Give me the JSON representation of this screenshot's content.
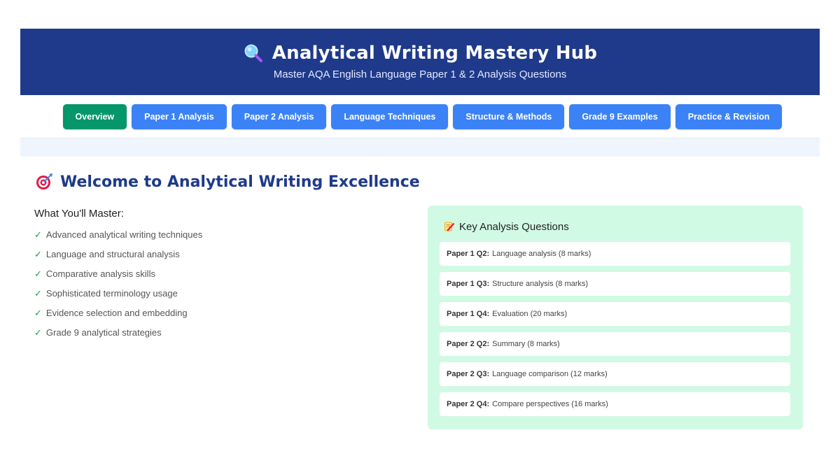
{
  "header": {
    "title": "Analytical Writing Mastery Hub",
    "subtitle": "Master AQA English Language Paper 1 & 2 Analysis Questions",
    "icon": "magnifier-icon"
  },
  "nav": {
    "items": [
      {
        "label": "Overview",
        "active": true
      },
      {
        "label": "Paper 1 Analysis",
        "active": false
      },
      {
        "label": "Paper 2 Analysis",
        "active": false
      },
      {
        "label": "Language Techniques",
        "active": false
      },
      {
        "label": "Structure & Methods",
        "active": false
      },
      {
        "label": "Grade 9 Examples",
        "active": false
      },
      {
        "label": "Practice & Revision",
        "active": false
      }
    ]
  },
  "welcome": {
    "title": "Welcome to Analytical Writing Excellence",
    "icon": "target-icon"
  },
  "master": {
    "heading": "What You'll Master:",
    "items": [
      "Advanced analytical writing techniques",
      "Language and structural analysis",
      "Comparative analysis skills",
      "Sophisticated terminology usage",
      "Evidence selection and embedding",
      "Grade 9 analytical strategies"
    ]
  },
  "questions": {
    "title": "Key Analysis Questions",
    "icon": "memo-icon",
    "items": [
      {
        "label": "Paper 1 Q2:",
        "text": "Language analysis (8 marks)"
      },
      {
        "label": "Paper 1 Q3:",
        "text": "Structure analysis (8 marks)"
      },
      {
        "label": "Paper 1 Q4:",
        "text": "Evaluation (20 marks)"
      },
      {
        "label": "Paper 2 Q2:",
        "text": "Summary (8 marks)"
      },
      {
        "label": "Paper 2 Q3:",
        "text": "Language comparison (12 marks)"
      },
      {
        "label": "Paper 2 Q4:",
        "text": "Compare perspectives (16 marks)"
      }
    ]
  },
  "colors": {
    "header_bg": "#1f3a8a",
    "nav_btn": "#3b82f6",
    "nav_active": "#059669",
    "card_bg": "#d1fae5",
    "check": "#16a34a"
  }
}
